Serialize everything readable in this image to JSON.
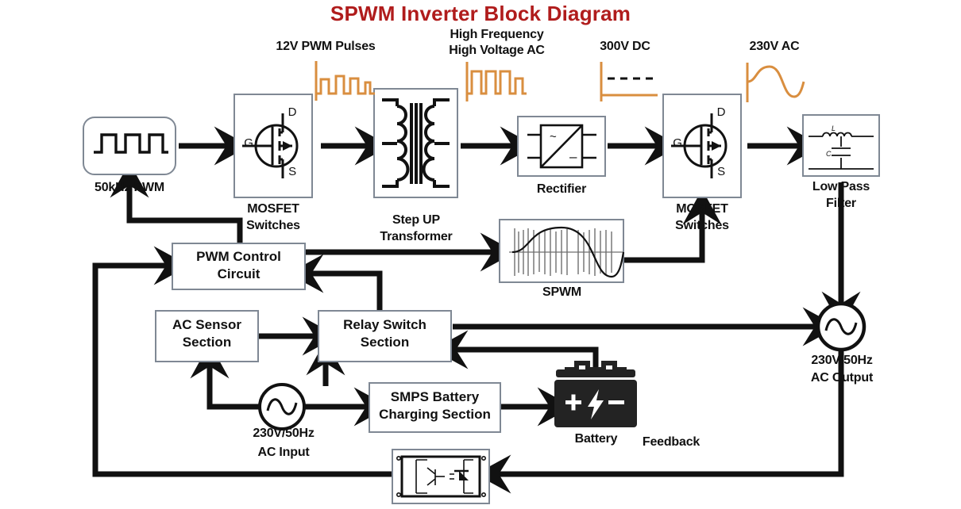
{
  "title": "SPWM Inverter Block Diagram",
  "theme": {
    "title_color": "#b01c1c",
    "wave_color": "#d98e3f",
    "box_border": "#7f8894",
    "line_color": "#111111",
    "battery_color": "#232323",
    "background": "#ffffff"
  },
  "signal_labels": [
    {
      "id": "pwm-pulses",
      "text": "12V PWM Pulses",
      "icon": "pwm-pulse-waveform"
    },
    {
      "id": "hf-hv-ac",
      "text": "High Frequency\nHigh Voltage AC",
      "icon": "hf-square-waveform"
    },
    {
      "id": "dc-300v",
      "text": "300V DC",
      "icon": "dc-level-waveform"
    },
    {
      "id": "ac-230v",
      "text": "230V AC",
      "icon": "sine-waveform"
    }
  ],
  "signal_label_lines": {
    "pwm_pulses": "12V PWM Pulses",
    "hf_hv_ac_l1": "High Frequency",
    "hf_hv_ac_l2": "High Voltage AC",
    "dc_300v": "300V DC",
    "ac_230v": "230V AC"
  },
  "blocks": {
    "pwm_source": {
      "label": "50kHz PWM",
      "icon": "square-wave-icon"
    },
    "mosfet_1": {
      "label_l1": "MOSFET",
      "label_l2": "Switches",
      "icon": "mosfet-symbol",
      "terminals": {
        "gate": "G",
        "drain": "D",
        "source": "S"
      }
    },
    "transformer": {
      "label_l1": "Step UP",
      "label_l2": "Transformer",
      "icon": "transformer-symbol"
    },
    "rectifier": {
      "label": "Rectifier",
      "icon": "rectifier-symbol",
      "symbols": {
        "ac": "~",
        "dc": "–"
      }
    },
    "mosfet_2": {
      "label_l1": "MOSFET",
      "label_l2": "Switches",
      "icon": "mosfet-symbol",
      "terminals": {
        "gate": "G",
        "drain": "D",
        "source": "S"
      }
    },
    "low_pass": {
      "label_l1": "Low Pass",
      "label_l2": "Filter",
      "icon": "lc-filter-symbol",
      "components": {
        "inductor": "L",
        "capacitor": "C"
      }
    },
    "pwm_control": {
      "label_l1": "PWM Control",
      "label_l2": "Circuit"
    },
    "spwm": {
      "label": "SPWM",
      "icon": "spwm-waveform-icon"
    },
    "ac_sensor": {
      "label_l1": "AC Sensor",
      "label_l2": "Section"
    },
    "relay_switch": {
      "label_l1": "Relay Switch",
      "label_l2": "Section"
    },
    "smps": {
      "label_l1": "SMPS Battery",
      "label_l2": "Charging Section"
    },
    "battery": {
      "label": "Battery",
      "icon": "battery-icon",
      "symbols": {
        "positive": "+",
        "negative": "–",
        "bolt": "⚡"
      }
    },
    "ac_input": {
      "label_l1": "230V/50Hz",
      "label_l2": "AC Input",
      "icon": "ac-source-icon"
    },
    "ac_output": {
      "label_l1": "230V/50Hz",
      "label_l2": "AC Output",
      "icon": "ac-source-icon"
    },
    "optocoupler": {
      "label": "",
      "icon": "optocoupler-symbol"
    }
  },
  "connections": {
    "feedback_label": "Feedback"
  }
}
